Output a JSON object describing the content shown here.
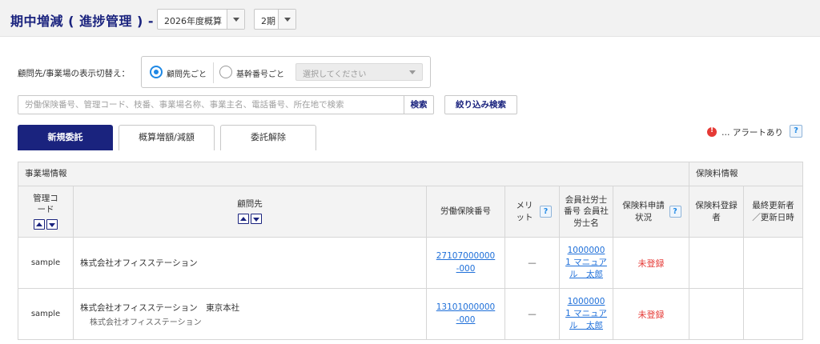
{
  "header": {
    "title": "期中増減 ( 進捗管理 ) -",
    "fiscal_year_select": "2026年度概算",
    "period_select": "2期"
  },
  "display_toggle": {
    "label": "顧問先/事業場の表示切替え：",
    "option_client": "顧問先ごと",
    "option_basic_number": "基幹番号ごと",
    "selected": "顧問先ごと",
    "select_placeholder": "選択してください"
  },
  "search": {
    "placeholder": "労働保険番号、管理コード、枝番、事業場名称、事業主名、電話番号、所在地で検索",
    "search_button": "検索",
    "filter_button": "絞り込み検索"
  },
  "tabs": [
    {
      "label": "新規委託",
      "active": true
    },
    {
      "label": "概算増額/減額",
      "active": false
    },
    {
      "label": "委託解除",
      "active": false
    }
  ],
  "alert_legend": {
    "text": "… アラートあり",
    "help": "?"
  },
  "table": {
    "group_headers": {
      "site_info": "事業場情報",
      "premium_info": "保険料情報"
    },
    "columns": {
      "management_code": "管理コード",
      "client": "顧問先",
      "labor_insurance_number": "労働保険番号",
      "merit": "メリット",
      "member_sharoushi": "会員社労士番号 会員社労士名",
      "premium_application_status": "保険料申請状況",
      "premium_registrant": "保険料登録者",
      "last_updated": "最終更新者／更新日時"
    },
    "help_icon": "?",
    "rows": [
      {
        "management_code": "sample",
        "client_name": "株式会社オフィスステーション",
        "client_sub": "",
        "labor_insurance_number": "27107000000-000",
        "merit": "—",
        "sharoushi": "10000001 マニュアル　太郎",
        "status": "未登録",
        "registrant": "",
        "last_updated": ""
      },
      {
        "management_code": "sample",
        "client_name": "株式会社オフィスステーション　東京本社",
        "client_sub": "株式会社オフィスステーション",
        "labor_insurance_number": "13101000000-000",
        "merit": "—",
        "sharoushi": "10000001 マニュアル　太郎",
        "status": "未登録",
        "registrant": "",
        "last_updated": ""
      }
    ]
  },
  "colors": {
    "primary_navy": "#1a237e",
    "link_blue": "#1e6fd9",
    "status_red": "#e53935",
    "radio_blue": "#1e88e5"
  }
}
